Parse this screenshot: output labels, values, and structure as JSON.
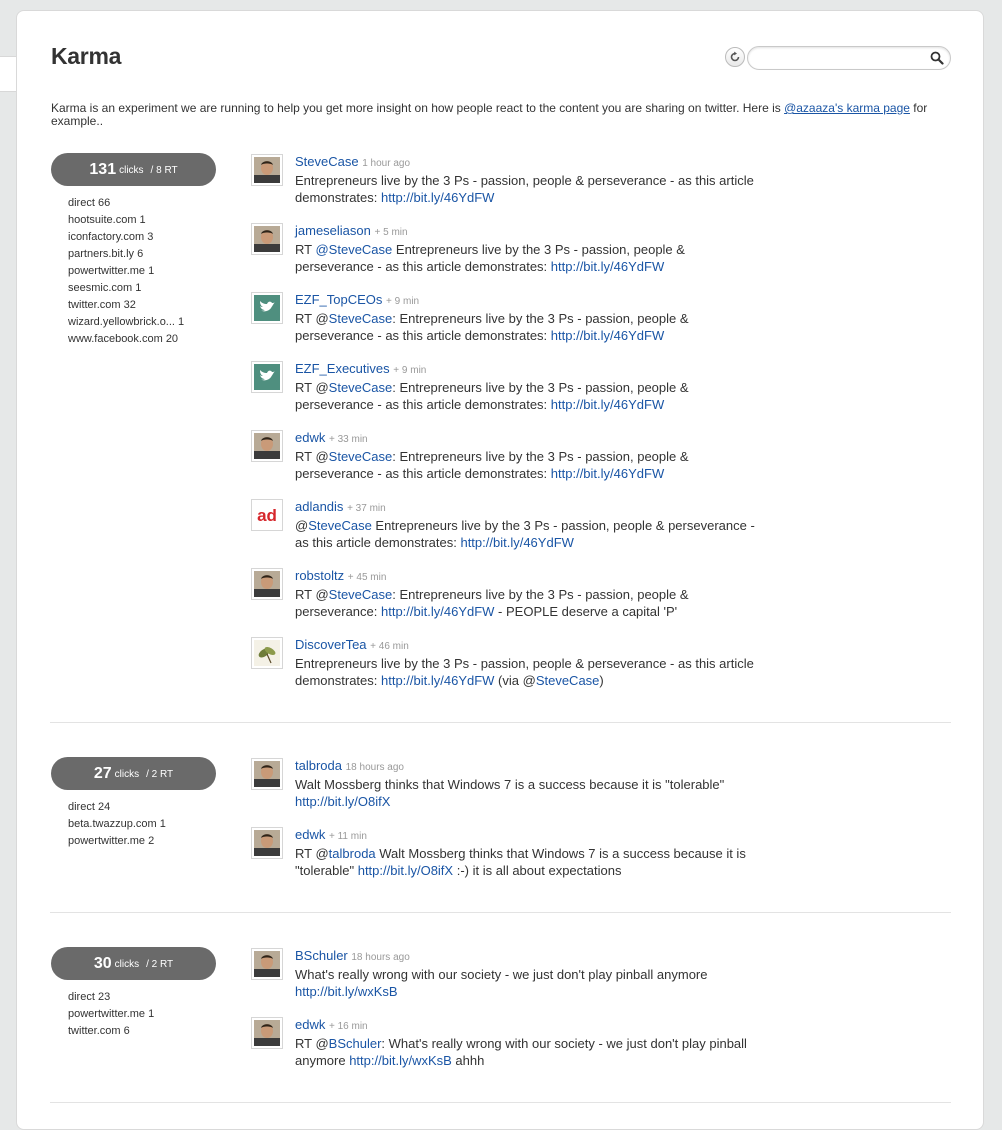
{
  "page": {
    "title": "Karma",
    "search": {
      "placeholder": "",
      "value": ""
    },
    "intro_text": "Karma is an experiment we are running to help you get more insight on how people react to the content you are sharing on twitter. Here is ",
    "intro_link": "@azaaza's karma page",
    "intro_suffix": " for example.."
  },
  "groups": [
    {
      "clicks": "131",
      "clicks_label": "clicks",
      "rt": "/ 8 RT",
      "referrers": [
        "direct 66",
        "hootsuite.com 1",
        "iconfactory.com 3",
        "partners.bit.ly 6",
        "powertwitter.me 1",
        "seesmic.com 1",
        "twitter.com 32",
        "wizard.yellowbrick.o... 1",
        "www.facebook.com 20"
      ],
      "tweets": [
        {
          "user": "SteveCase",
          "time": "1 hour ago",
          "avatar_icon": "person-photo-icon",
          "parts": [
            "Entrepreneurs live by the 3 Ps - passion, people & perseverance - as this article demonstrates: ",
            "http://bit.ly/46YdFW"
          ]
        },
        {
          "user": "jameseliason",
          "time": "+ 5 min",
          "avatar_icon": "person-photo-icon",
          "parts": [
            "RT ",
            "@SteveCase",
            " Entrepreneurs live by the 3 Ps - passion, people & perseverance - as this article demonstrates: ",
            "http://bit.ly/46YdFW"
          ]
        },
        {
          "user": "EZF_TopCEOs",
          "time": "+ 9 min",
          "avatar_icon": "twitter-bird-icon",
          "parts": [
            "RT @",
            "SteveCase",
            ": Entrepreneurs live by the 3 Ps - passion, people & perseverance - as this article demonstrates: ",
            "http://bit.ly/46YdFW"
          ]
        },
        {
          "user": "EZF_Executives",
          "time": "+ 9 min",
          "avatar_icon": "twitter-bird-icon",
          "parts": [
            "RT @",
            "SteveCase",
            ": Entrepreneurs live by the 3 Ps - passion, people & perseverance - as this article demonstrates: ",
            "http://bit.ly/46YdFW"
          ]
        },
        {
          "user": "edwk",
          "time": "+ 33 min",
          "avatar_icon": "person-photo-icon",
          "parts": [
            "RT @",
            "SteveCase",
            ": Entrepreneurs live by the 3 Ps - passion, people & perseverance - as this article demonstrates: ",
            "http://bit.ly/46YdFW"
          ]
        },
        {
          "user": "adlandis",
          "time": "+ 37 min",
          "avatar_icon": "ad-logo-icon",
          "avatar_text": "ad",
          "parts": [
            "@",
            "SteveCase",
            " Entrepreneurs live by the 3 Ps - passion, people & perseverance - as this article demonstrates: ",
            "http://bit.ly/46YdFW"
          ]
        },
        {
          "user": "robstoltz",
          "time": "+ 45 min",
          "avatar_icon": "person-photo-icon",
          "parts": [
            "RT @",
            "SteveCase",
            ": Entrepreneurs live by the 3 Ps - passion, people & perseverance: ",
            "http://bit.ly/46YdFW",
            " - PEOPLE deserve a capital 'P'"
          ]
        },
        {
          "user": "DiscoverTea",
          "time": "+ 46 min",
          "avatar_icon": "tea-leaf-icon",
          "parts": [
            "Entrepreneurs live by the 3 Ps - passion, people & perseverance - as this article demonstrates: ",
            "http://bit.ly/46YdFW",
            " (via @",
            "SteveCase",
            ")"
          ]
        }
      ]
    },
    {
      "clicks": "27",
      "clicks_label": "clicks",
      "rt": "/ 2 RT",
      "referrers": [
        "direct 24",
        "beta.twazzup.com 1",
        "powertwitter.me 2"
      ],
      "tweets": [
        {
          "user": "talbroda",
          "time": "18 hours ago",
          "avatar_icon": "person-photo-icon",
          "parts": [
            "Walt Mossberg thinks that Windows 7 is a success because it is \"tolerable\" ",
            "http://bit.ly/O8ifX"
          ]
        },
        {
          "user": "edwk",
          "time": "+ 11 min",
          "avatar_icon": "person-photo-icon",
          "parts": [
            "RT @",
            "talbroda",
            " Walt Mossberg thinks that Windows 7 is a success because it is \"tolerable\" ",
            "http://bit.ly/O8ifX",
            " :-) it is all about expectations"
          ]
        }
      ]
    },
    {
      "clicks": "30",
      "clicks_label": "clicks",
      "rt": "/ 2 RT",
      "referrers": [
        "direct 23",
        "powertwitter.me 1",
        "twitter.com 6"
      ],
      "tweets": [
        {
          "user": "BSchuler",
          "time": "18 hours ago",
          "avatar_icon": "person-photo-icon",
          "parts": [
            "What's really wrong with our society - we just don't play pinball anymore ",
            "http://bit.ly/wxKsB"
          ]
        },
        {
          "user": "edwk",
          "time": "+ 16 min",
          "avatar_icon": "person-photo-icon",
          "parts": [
            "RT @",
            "BSchuler",
            ": What's really wrong with our society - we just don't play pinball anymore ",
            "http://bit.ly/wxKsB",
            " ahhh"
          ]
        }
      ]
    }
  ],
  "colors": {
    "link": "#1a55a5",
    "pill": "#6a6a6a",
    "text": "#333333",
    "muted": "#999999"
  }
}
